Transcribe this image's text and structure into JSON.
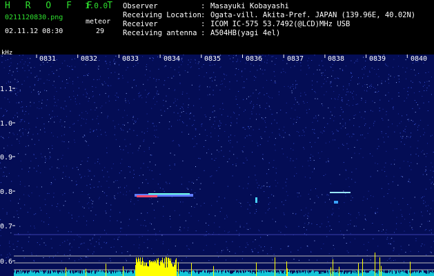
{
  "header": {
    "app_title": "H R O F F T",
    "version": "1.0.0",
    "filename": "0211120830.png",
    "datetime": "02.11.12 08:30",
    "meteor_label": "meteor",
    "meteor_count": "29",
    "info_rows": [
      {
        "key": "Observer",
        "value": "Masayuki Kobayashi"
      },
      {
        "key": "Receiving Location",
        "value": "Ogata-vill. Akita-Pref. JAPAN (139.96E, 40.02N)"
      },
      {
        "key": "Receiver",
        "value": "ICOM IC-575 53.7492(@LCD)MHz USB"
      },
      {
        "key": "Receiving antenna",
        "value": "A504HB(yagi 4el)"
      }
    ],
    "colon": ":"
  },
  "axes": {
    "y_unit": "kHz",
    "y_ticks": [
      "1.1",
      "1.0",
      "0.9",
      "0.8",
      "0.7",
      "0.6"
    ],
    "x_ticks": [
      "0831",
      "0832",
      "0833",
      "0834",
      "0835",
      "0836",
      "0837",
      "0838",
      "0839",
      "0840"
    ]
  },
  "colors": {
    "background": "#040d55",
    "label_green": "#2fe12f",
    "text": "#ffffff",
    "signal_strong": "#ffff00",
    "signal_mid": "#00ffff"
  }
}
